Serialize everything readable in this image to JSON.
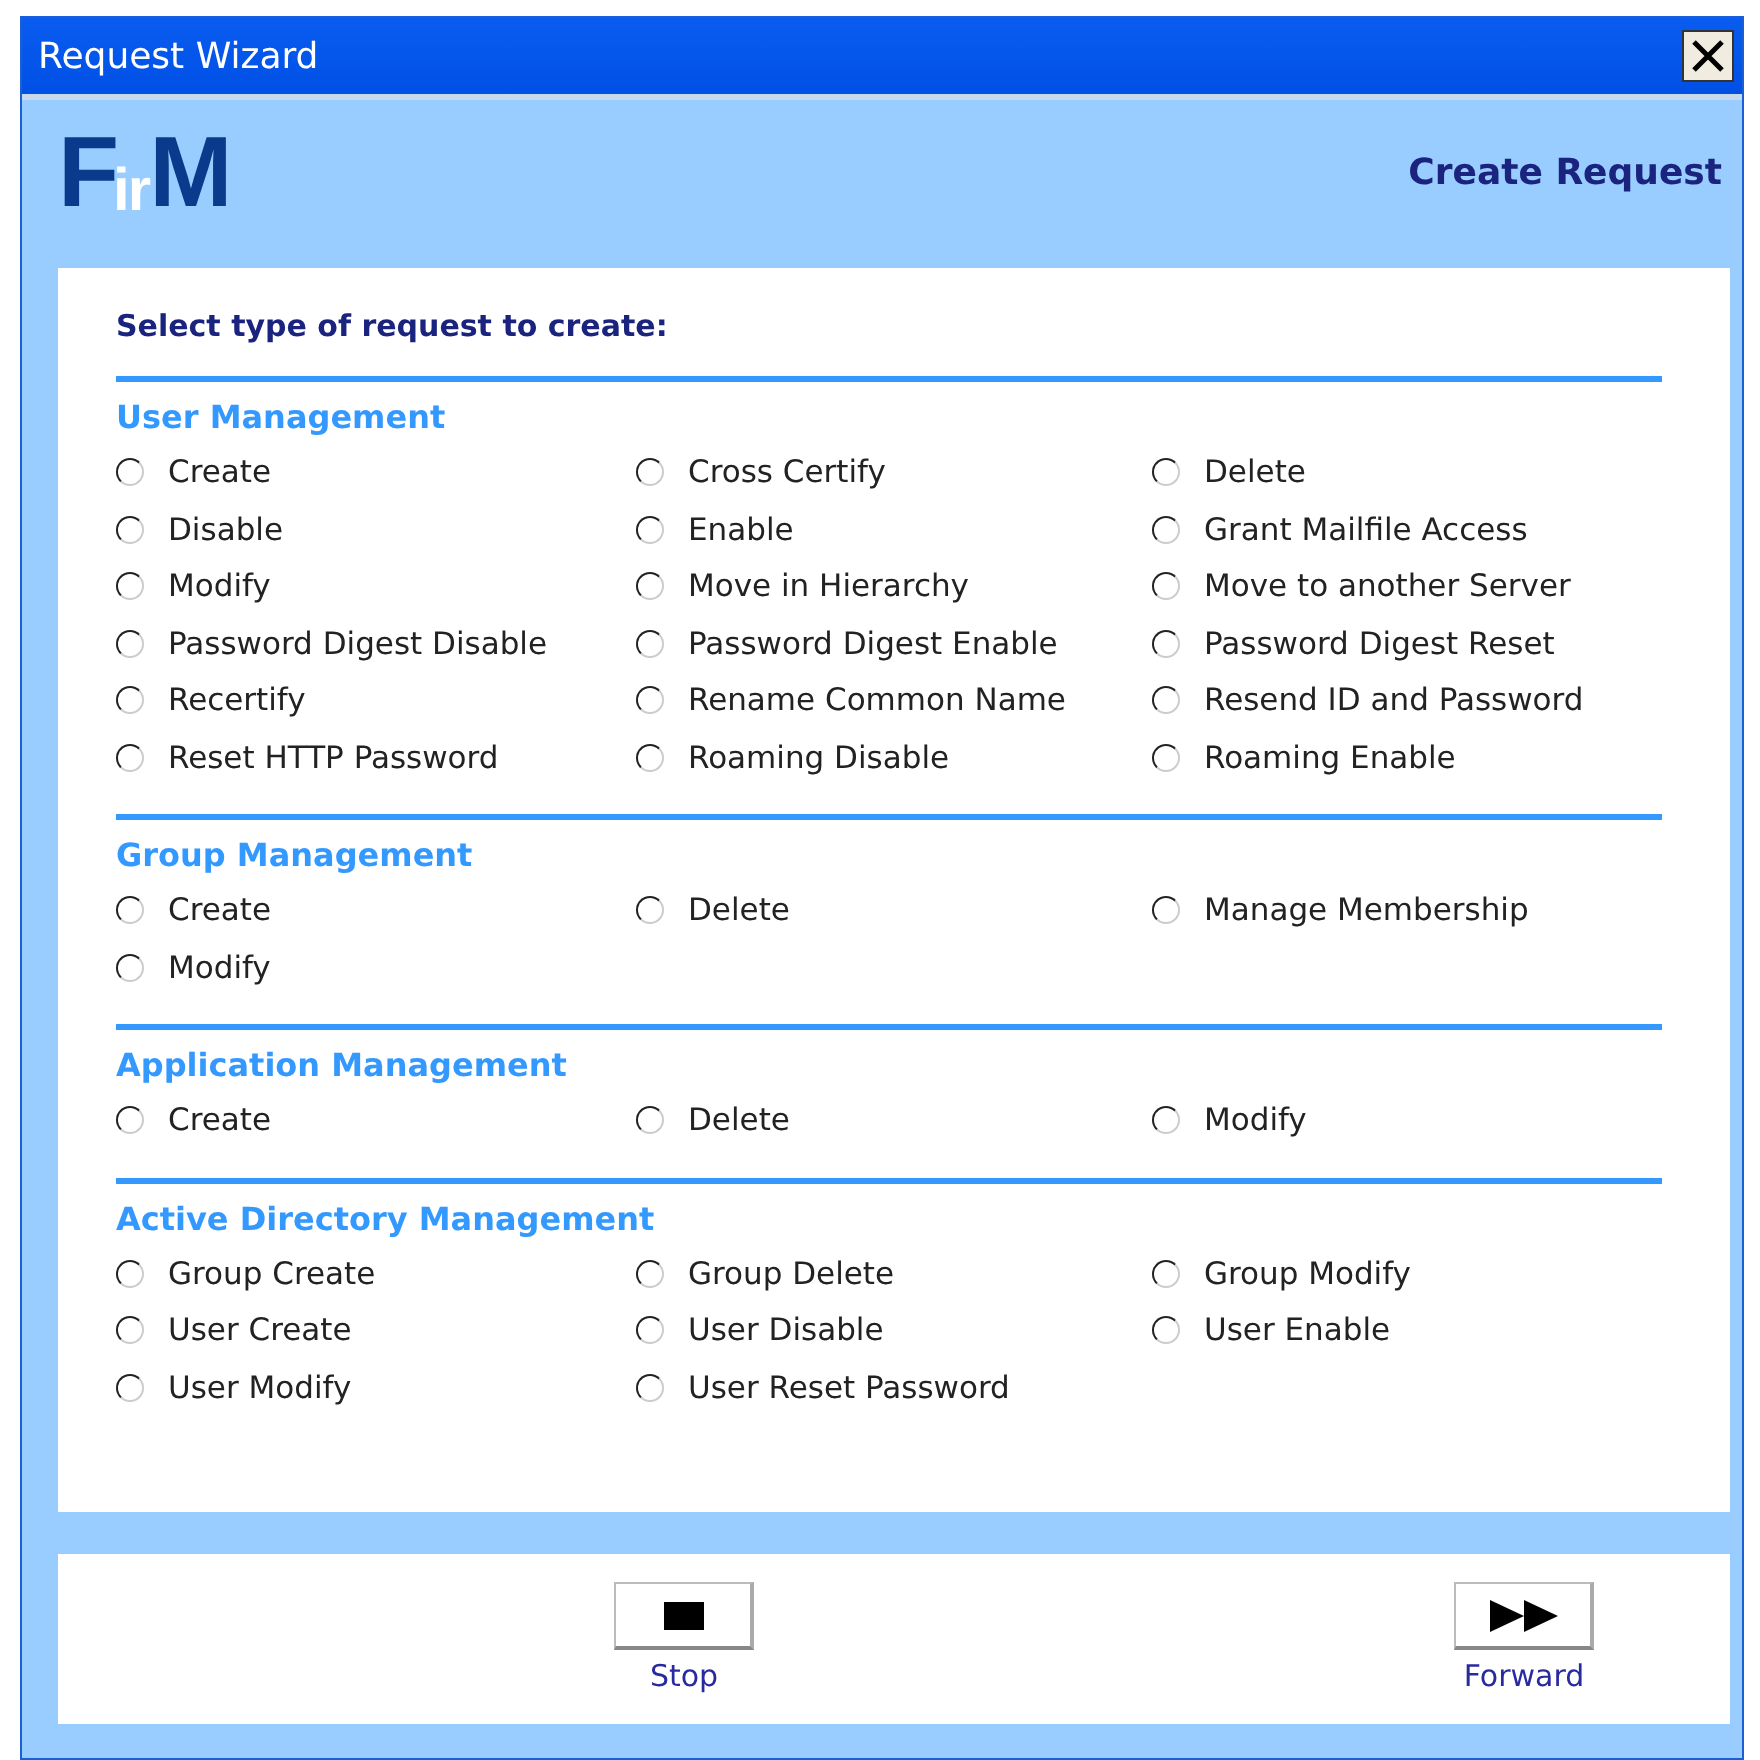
{
  "window": {
    "title": "Request Wizard"
  },
  "header": {
    "logo": "F$_{ir}$M",
    "title": "Create Request"
  },
  "prompt": "Select type of request to create:",
  "sections": [
    {
      "title": "User Management",
      "options": [
        {
          "label": "Create",
          "selected": false
        },
        {
          "label": "Cross Certify",
          "selected": false
        },
        {
          "label": "Delete",
          "selected": false
        },
        {
          "label": "Disable",
          "selected": false
        },
        {
          "label": "Enable",
          "selected": false
        },
        {
          "label": "Grant Mailfile Access",
          "selected": false
        },
        {
          "label": "Modify",
          "selected": false
        },
        {
          "label": "Move in Hierarchy",
          "selected": false
        },
        {
          "label": "Move to another Server",
          "selected": false
        },
        {
          "label": "Password Digest Disable",
          "selected": false
        },
        {
          "label": "Password Digest Enable",
          "selected": false
        },
        {
          "label": "Password Digest Reset",
          "selected": false
        },
        {
          "label": "Recertify",
          "selected": false
        },
        {
          "label": "Rename Common Name",
          "selected": false
        },
        {
          "label": "Resend ID and Password",
          "selected": false
        },
        {
          "label": "Reset HTTP Password",
          "selected": false
        },
        {
          "label": "Roaming Disable",
          "selected": false
        },
        {
          "label": "Roaming Enable",
          "selected": false
        }
      ]
    },
    {
      "title": "Group Management",
      "options": [
        {
          "label": "Create",
          "selected": false
        },
        {
          "label": "Delete",
          "selected": false
        },
        {
          "label": "Manage Membership",
          "selected": false
        },
        {
          "label": "Modify",
          "selected": false
        }
      ]
    },
    {
      "title": "Application Management",
      "options": [
        {
          "label": "Create",
          "selected": false
        },
        {
          "label": "Delete",
          "selected": false
        },
        {
          "label": "Modify",
          "selected": false
        }
      ]
    },
    {
      "title": "Active Directory Management",
      "options": [
        {
          "label": "Group Create",
          "selected": false
        },
        {
          "label": "Group Delete",
          "selected": false
        },
        {
          "label": "Group Modify",
          "selected": false
        },
        {
          "label": "User Create",
          "selected": false
        },
        {
          "label": "User Disable",
          "selected": false
        },
        {
          "label": "User Enable",
          "selected": false
        },
        {
          "label": "User Modify",
          "selected": false
        },
        {
          "label": "User Reset Password",
          "selected": false
        }
      ]
    }
  ],
  "buttons": [
    {
      "kind": "stop",
      "label": "Stop"
    },
    {
      "kind": "forward",
      "label": "Forward"
    }
  ]
}
